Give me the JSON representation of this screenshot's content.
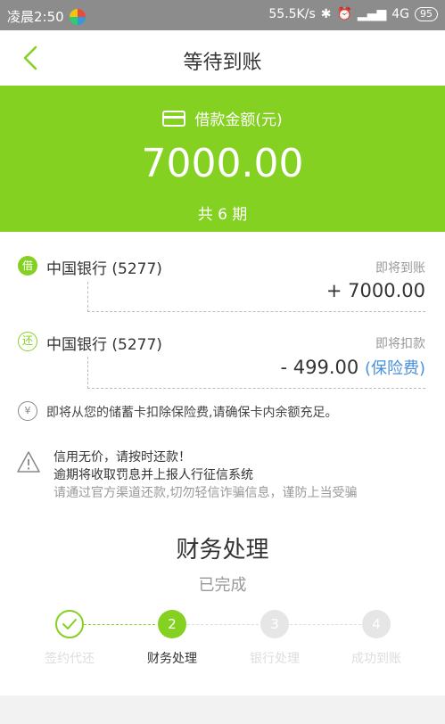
{
  "status_bar": {
    "time": "凌晨2:50",
    "network_speed": "55.5K/s",
    "signal": "4G",
    "battery": "95"
  },
  "header": {
    "title": "等待到账"
  },
  "summary": {
    "label": "借款金额(元)",
    "amount": "7000.00",
    "periods": "共 6 期"
  },
  "transactions": [
    {
      "badge": "借",
      "bank": "中国银行 (5277)",
      "status": "即将到账",
      "amount": "+ 7000.00",
      "extra": ""
    },
    {
      "badge": "还",
      "bank": "中国银行 (5277)",
      "status": "即将扣款",
      "amount": "- 499.00",
      "extra": "(保险费)"
    }
  ],
  "notice": {
    "icon_glyph": "¥",
    "text": "即将从您的储蓄卡扣除保险费,请确保卡内余额充足。"
  },
  "warning": {
    "line1": "信用无价，请按时还款！",
    "line2": "逾期将收取罚息并上报人行征信系统",
    "line3": "请通过官方渠道还款,切勿轻信诈骗信息，谨防上当受骗"
  },
  "process": {
    "title": "财务处理",
    "status": "已完成",
    "steps": [
      {
        "number": "1",
        "label": "签约代还",
        "state": "done"
      },
      {
        "number": "2",
        "label": "财务处理",
        "state": "active"
      },
      {
        "number": "3",
        "label": "银行处理",
        "state": "todo"
      },
      {
        "number": "4",
        "label": "成功到账",
        "state": "todo"
      }
    ]
  },
  "colors": {
    "accent": "#84d122",
    "link": "#4a90d9",
    "status_bar": "#8c8c8c"
  }
}
